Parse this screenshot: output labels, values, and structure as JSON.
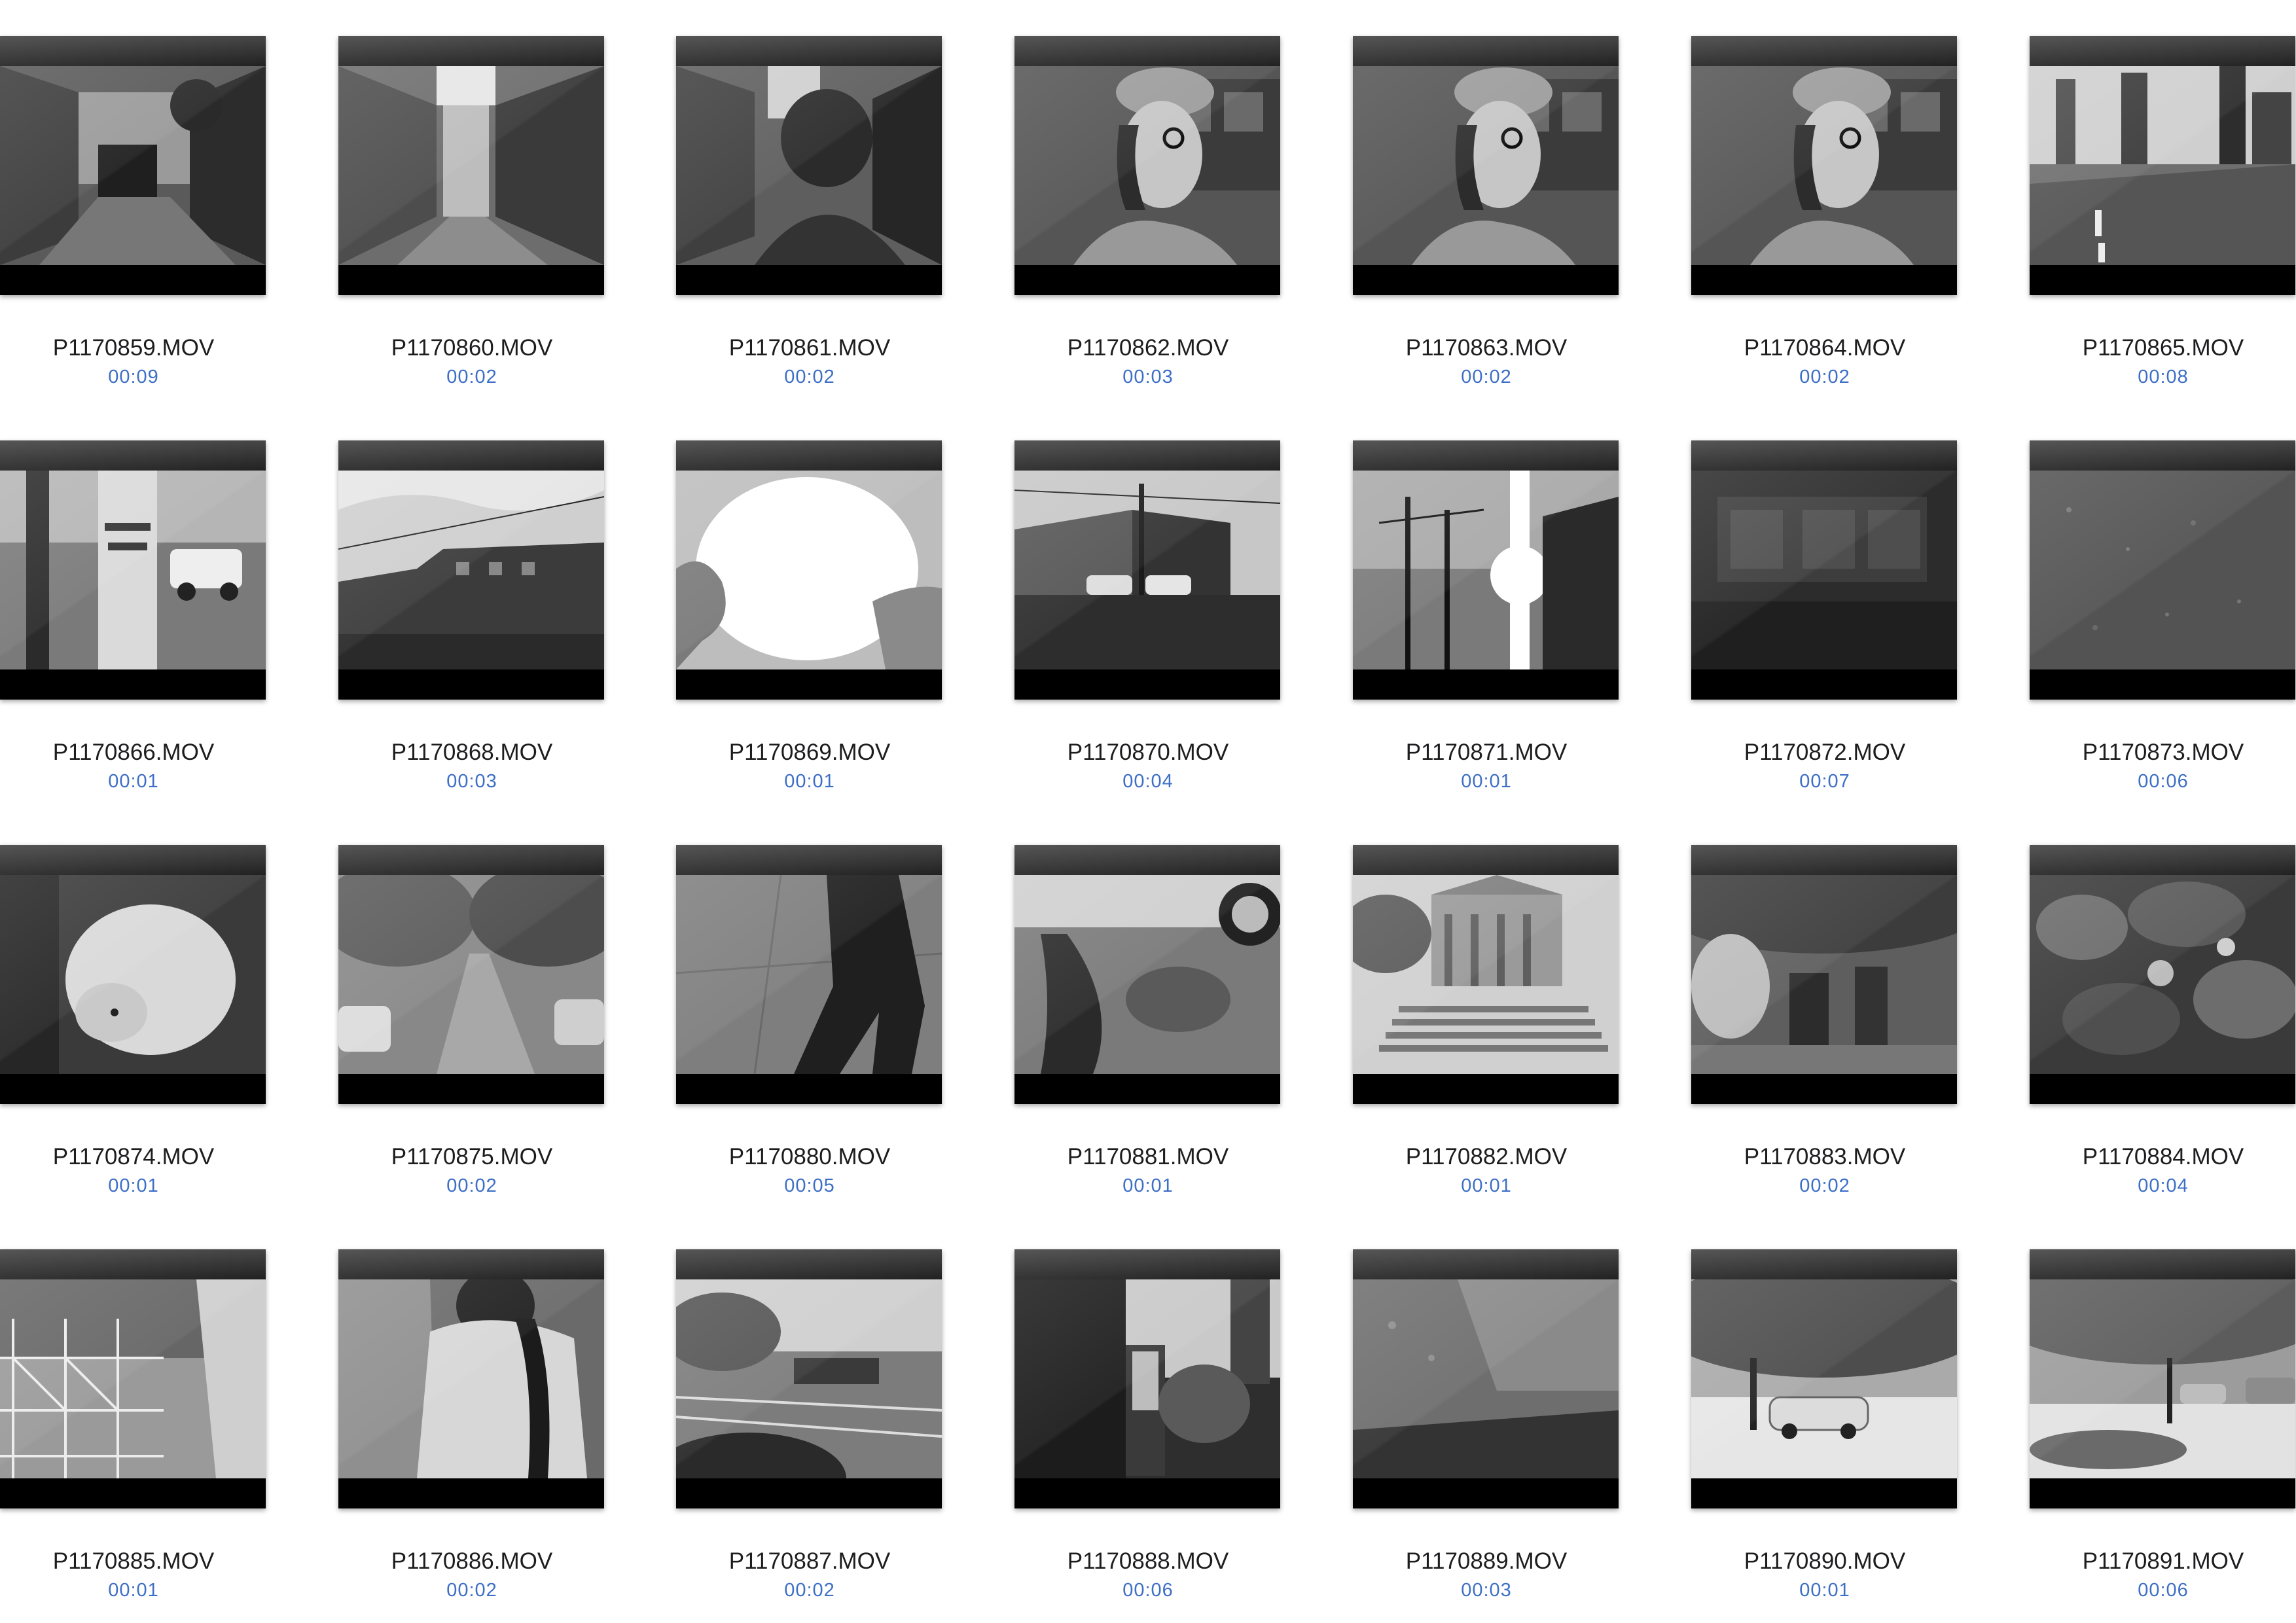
{
  "browser": {
    "items": [
      {
        "name": "P1170859.MOV",
        "duration": "00:09",
        "scene": "alley-left"
      },
      {
        "name": "P1170860.MOV",
        "duration": "00:02",
        "scene": "alley-center"
      },
      {
        "name": "P1170861.MOV",
        "duration": "00:02",
        "scene": "alley-person"
      },
      {
        "name": "P1170862.MOV",
        "duration": "00:03",
        "scene": "person-cap"
      },
      {
        "name": "P1170863.MOV",
        "duration": "00:02",
        "scene": "person-cap"
      },
      {
        "name": "P1170864.MOV",
        "duration": "00:02",
        "scene": "person-cap"
      },
      {
        "name": "P1170865.MOV",
        "duration": "00:08",
        "scene": "street-road"
      },
      {
        "name": "P1170866.MOV",
        "duration": "00:01",
        "scene": "poster-pole"
      },
      {
        "name": "P1170868.MOV",
        "duration": "00:03",
        "scene": "buildings-sky"
      },
      {
        "name": "P1170869.MOV",
        "duration": "00:01",
        "scene": "bright-flare"
      },
      {
        "name": "P1170870.MOV",
        "duration": "00:04",
        "scene": "corner-building"
      },
      {
        "name": "P1170871.MOV",
        "duration": "00:01",
        "scene": "sun-poles"
      },
      {
        "name": "P1170872.MOV",
        "duration": "00:07",
        "scene": "dark-street"
      },
      {
        "name": "P1170873.MOV",
        "duration": "00:06",
        "scene": "texture"
      },
      {
        "name": "P1170874.MOV",
        "duration": "00:01",
        "scene": "dog"
      },
      {
        "name": "P1170875.MOV",
        "duration": "00:02",
        "scene": "tree-street"
      },
      {
        "name": "P1170880.MOV",
        "duration": "00:05",
        "scene": "shadow-pavement"
      },
      {
        "name": "P1170881.MOV",
        "duration": "00:01",
        "scene": "car-shadow"
      },
      {
        "name": "P1170882.MOV",
        "duration": "00:01",
        "scene": "library-steps"
      },
      {
        "name": "P1170883.MOV",
        "duration": "00:02",
        "scene": "crowd-park"
      },
      {
        "name": "P1170884.MOV",
        "duration": "00:04",
        "scene": "leaves"
      },
      {
        "name": "P1170885.MOV",
        "duration": "00:01",
        "scene": "scaffold"
      },
      {
        "name": "P1170886.MOV",
        "duration": "00:02",
        "scene": "people-back"
      },
      {
        "name": "P1170887.MOV",
        "duration": "00:02",
        "scene": "tram-lines"
      },
      {
        "name": "P1170888.MOV",
        "duration": "00:06",
        "scene": "building-sign"
      },
      {
        "name": "P1170889.MOV",
        "duration": "00:03",
        "scene": "pavement-shadow"
      },
      {
        "name": "P1170890.MOV",
        "duration": "00:01",
        "scene": "car-street"
      },
      {
        "name": "P1170891.MOV",
        "duration": "00:06",
        "scene": "sunny-street"
      }
    ]
  }
}
